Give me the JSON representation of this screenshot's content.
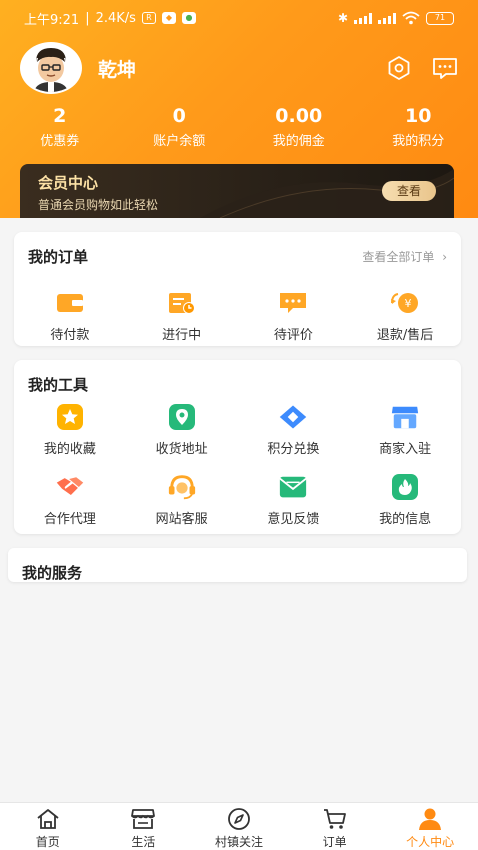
{
  "status_bar": {
    "time": "上午9:21",
    "speed": "2.4K/s",
    "battery": "71"
  },
  "profile": {
    "username": "乾坤"
  },
  "stats": [
    {
      "value": "2",
      "label": "优惠券"
    },
    {
      "value": "0",
      "label": "账户余额"
    },
    {
      "value": "0.00",
      "label": "我的佣金"
    },
    {
      "value": "10",
      "label": "我的积分"
    }
  ],
  "member": {
    "title": "会员中心",
    "subtitle": "普通会员购物如此轻松",
    "button": "查看"
  },
  "orders": {
    "title": "我的订单",
    "view_all": "查看全部订单",
    "items": [
      {
        "label": "待付款",
        "icon": "wallet-icon"
      },
      {
        "label": "进行中",
        "icon": "calendar-clock-icon"
      },
      {
        "label": "待评价",
        "icon": "comment-icon"
      },
      {
        "label": "退款/售后",
        "icon": "refund-icon"
      }
    ]
  },
  "tools": {
    "title": "我的工具",
    "items": [
      {
        "label": "我的收藏",
        "icon": "star-icon"
      },
      {
        "label": "收货地址",
        "icon": "location-icon"
      },
      {
        "label": "积分兑换",
        "icon": "diamond-icon"
      },
      {
        "label": "商家入驻",
        "icon": "store-icon"
      },
      {
        "label": "合作代理",
        "icon": "handshake-icon"
      },
      {
        "label": "网站客服",
        "icon": "headset-icon"
      },
      {
        "label": "意见反馈",
        "icon": "mail-icon"
      },
      {
        "label": "我的信息",
        "icon": "flame-icon"
      }
    ]
  },
  "services": {
    "title": "我的服务"
  },
  "tabbar": {
    "items": [
      {
        "label": "首页",
        "icon": "home-icon"
      },
      {
        "label": "生活",
        "icon": "shop-icon"
      },
      {
        "label": "村镇关注",
        "icon": "compass-icon"
      },
      {
        "label": "订单",
        "icon": "cart-icon"
      },
      {
        "label": "个人中心",
        "icon": "person-icon"
      }
    ],
    "active": "个人中心"
  },
  "colors": {
    "brand": "#ff8a12",
    "member_bg": "#2a2118",
    "member_gold": "#fde2a6"
  }
}
